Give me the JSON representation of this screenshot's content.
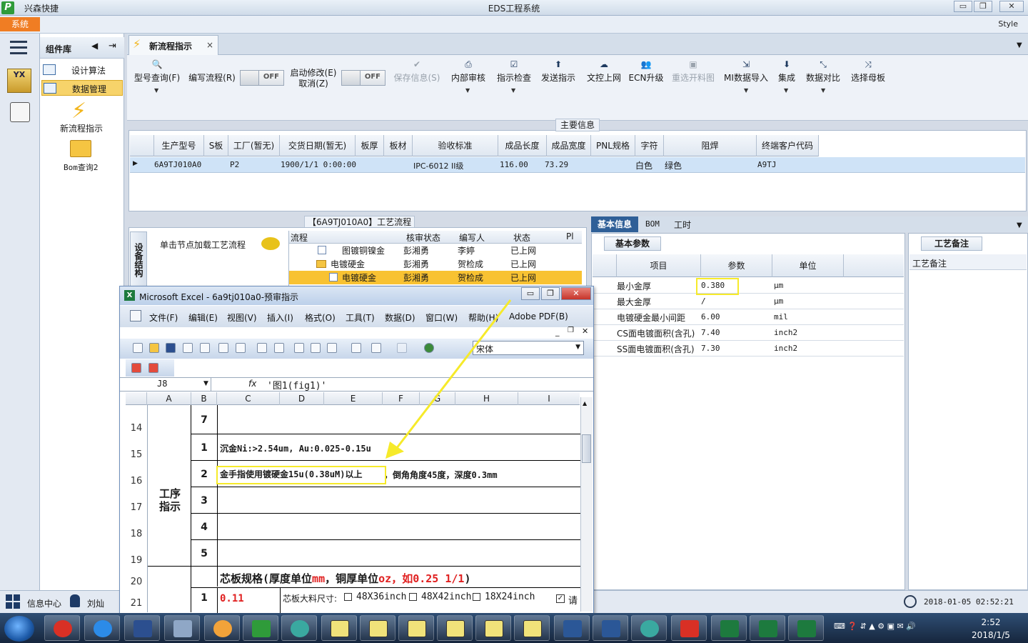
{
  "app": {
    "logo_letter": "P",
    "company": "兴森快捷",
    "title": "EDS工程系统",
    "style_label": "Style",
    "system_tab": "系统"
  },
  "window_controls": {
    "minimize": "▭",
    "restore": "❐",
    "close": "✕"
  },
  "component_panel": {
    "title": "组件库",
    "items": [
      {
        "label": "设计算法"
      },
      {
        "label": "数据管理"
      }
    ],
    "launchers": [
      {
        "label": "新流程指示"
      },
      {
        "label": "Bom查询2"
      }
    ]
  },
  "doc_tab": {
    "label": "新流程指示",
    "close": "×"
  },
  "toolbar": {
    "items": [
      {
        "label": "型号查询(F)",
        "icon": "search-icon"
      },
      {
        "label": "编写流程(R)",
        "icon": "none"
      },
      {
        "label": "启动修改(E)",
        "label2": "取消(Z)"
      },
      {
        "label": "保存信息(S)",
        "icon": "check-icon",
        "disabled": true
      },
      {
        "label": "内部审核",
        "icon": "print-icon"
      },
      {
        "label": "指示检查",
        "icon": "checkbox-icon"
      },
      {
        "label": "发送指示",
        "icon": "upload-icon"
      },
      {
        "label": "文控上网",
        "icon": "cloud-upload-icon"
      },
      {
        "label": "ECN升级",
        "icon": "users-icon"
      },
      {
        "label": "重选开料图",
        "icon": "image-icon",
        "disabled": true
      },
      {
        "label": "MI数据导入",
        "icon": "import-icon"
      },
      {
        "label": "集成",
        "icon": "download-icon"
      },
      {
        "label": "数据对比",
        "icon": "compare-icon"
      },
      {
        "label": "选择母板",
        "icon": "shuffle-icon"
      }
    ],
    "toggle_off": "OFF"
  },
  "main_info": {
    "legend": "主要信息",
    "columns": [
      "生产型号",
      "S板",
      "工厂(暂无)",
      "交货日期(暂无)",
      "板厚",
      "板材",
      "验收标准",
      "成品长度",
      "成品宽度",
      "PNL规格",
      "字符",
      "阻焊",
      "终端客户代码"
    ],
    "row": {
      "model": "6A9TJ010A0",
      "factory": "P2",
      "date": "1900/1/1 0:00:00",
      "standard": "IPC-6012 II级",
      "length": "116.00",
      "width": "73.29",
      "char": "白色",
      "mask": "绿色",
      "customer": "A9TJ"
    }
  },
  "process": {
    "legend": "【6A9TJ010A0】工艺流程",
    "side_tab": "设备结构",
    "node_label": "单击节点加载工艺流程",
    "tree_columns": [
      "流程",
      "核审状态",
      "编写人",
      "状态",
      "Pl"
    ],
    "rows": [
      {
        "name": "图镀铜镍金",
        "review": "彭湘勇",
        "author": "李婷",
        "status": "已上网"
      },
      {
        "name": "电镀硬金",
        "review": "彭湘勇",
        "author": "贺检成",
        "status": "已上网"
      },
      {
        "name": "电镀硬金",
        "review": "彭湘勇",
        "author": "贺检成",
        "status": "已上网"
      }
    ]
  },
  "right": {
    "tabs": [
      "基本信息",
      "BOM",
      "工时"
    ],
    "param_tab": "基本参数",
    "columns": [
      "项目",
      "参数",
      "单位"
    ],
    "rows": [
      {
        "item": "最小金厚",
        "value": "0.380",
        "unit": "μm"
      },
      {
        "item": "最大金厚",
        "value": "/",
        "unit": "μm"
      },
      {
        "item": "电镀硬金最小间距",
        "value": "6.00",
        "unit": "mil"
      },
      {
        "item": "CS面电镀面积(含孔)",
        "value": "7.40",
        "unit": "inch2"
      },
      {
        "item": "SS面电镀面积(含孔)",
        "value": "7.30",
        "unit": "inch2"
      }
    ],
    "notes_tab": "工艺备注",
    "notes_row": "工艺备注"
  },
  "status": {
    "info_center": "信息中心",
    "user": "刘灿",
    "datetime": "2018-01-05 02:52:21"
  },
  "excel": {
    "title": "Microsoft Excel - 6a9tj010a0-预审指示",
    "menu": [
      "文件(F)",
      "编辑(E)",
      "视图(V)",
      "插入(I)",
      "格式(O)",
      "工具(T)",
      "数据(D)",
      "窗口(W)",
      "帮助(H)",
      "Adobe PDF(B)"
    ],
    "font": "宋体",
    "namebox": "J8",
    "fx": "fx",
    "formula": "'图1(fig1)'",
    "columns": [
      "A",
      "B",
      "C",
      "D",
      "E",
      "F",
      "G",
      "H",
      "I"
    ],
    "rows": [
      "14",
      "15",
      "16",
      "17",
      "18",
      "19",
      "20",
      "21"
    ],
    "b_values": [
      "7",
      "1",
      "2",
      "3",
      "4",
      "5",
      "1"
    ],
    "a_merged": "工序指示",
    "cell_c15": "沉金Ni:>2.54um, Au:0.025-0.15u",
    "cell_c16a": "金手指使用镀硬金15u(0.38uM)以上",
    "cell_c16b": "，倒角角度45度，深度0.3mm",
    "row20_a": "芯板规格(厚度单位",
    "row20_b": "mm",
    "row20_c": "，铜厚单位",
    "row20_d": "oz",
    "row20_e": "，如0.25 1/1",
    "row20_f": ")",
    "cell_c21": "0.11",
    "cell_d21": "芯板大料尺寸:",
    "opt1": "48X36inch",
    "opt2": "48X42inch",
    "opt3": "18X24inch",
    "cell_i21": "请"
  },
  "taskbar": {
    "time": "2:52",
    "date": "2018/1/5"
  },
  "colors": {
    "accent": "#2f5f97",
    "highlight": "#f6ea2a",
    "system_tab": "#f07d23"
  }
}
